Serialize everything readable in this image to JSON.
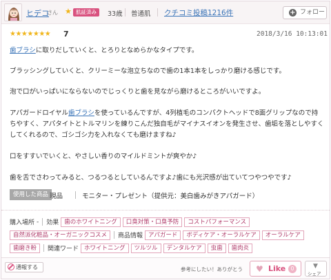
{
  "user": {
    "name": "ヒデコ",
    "honorific": "さん",
    "verified_label": "肌証済み",
    "age": "33歳",
    "skin_type": "普通肌",
    "review_count_label": "クチコミ投稿1216件",
    "follow_label": "フォロー"
  },
  "review": {
    "stars": "★★★★★★★",
    "score": "7",
    "date": "2018/3/16 10:13:01",
    "p1_link": "歯ブラシ",
    "p1_text": "に取りだしていくと、とろりとなめらかなタイプです。",
    "p2": "ブラッシングしていくと、クリーミーな泡立ちなので歯の1本1本をしっかり磨ける感じです。",
    "p3": "泡で口がいっぱいにならないのでじっくりと歯を見ながら磨けるところがいいですよ。",
    "p4_pre": "アパガードロイヤル",
    "p4_link": "歯ブラシ",
    "p4_post": "を使っているんですが、4列植毛のコンパクトヘッドで8面グリップなので持ちやすく、アパタイトとトルマリンを練りこんだ独自毛がマイナスイオンを発生させ、歯垢を落としやすくしてくれるので、ゴシゴシ力を入れなくても磨けますね♪",
    "p5": "口をすすいでいくと、やさしい香りのマイルドミントが爽やか♪",
    "p6": "歯を舌でさわってみると、つるつるとしているんですよ♪歯にも光沢感が出ていてつやつやです♪"
  },
  "usage": {
    "tag": "使用した商品",
    "status": "現品",
    "detail": "モニター・プレゼント（提供元：美白歯みがきアパガード）"
  },
  "tags": {
    "row1": {
      "label1": "購入場所",
      "label2": "効果",
      "items": [
        "歯のホワイトニング",
        "口臭対策・口臭予防",
        "コストパフォーマンス"
      ]
    },
    "row2": {
      "items_before": [
        "自然派化粧品・オーガニックコスメ"
      ],
      "label": "商品情報",
      "items_after": [
        "アパガード",
        "ボディケア・オーラルケア",
        "オーラルケア"
      ]
    },
    "row3": {
      "items_before": [
        "歯磨き粉"
      ],
      "label": "関連ワード",
      "items_after": [
        "ホワイトニング",
        "ツルツル",
        "デンタルケア",
        "虫歯",
        "歯肉炎"
      ]
    }
  },
  "footer": {
    "report_label": "通報する",
    "helpful_text": "参考にしたい！ありがとう",
    "like_label": "Like",
    "like_count": "0",
    "share_label": "シェア"
  },
  "colors": {
    "accent_pink": "#d9527f",
    "link_blue": "#3a74b8",
    "star_gold": "#f0b51a"
  }
}
